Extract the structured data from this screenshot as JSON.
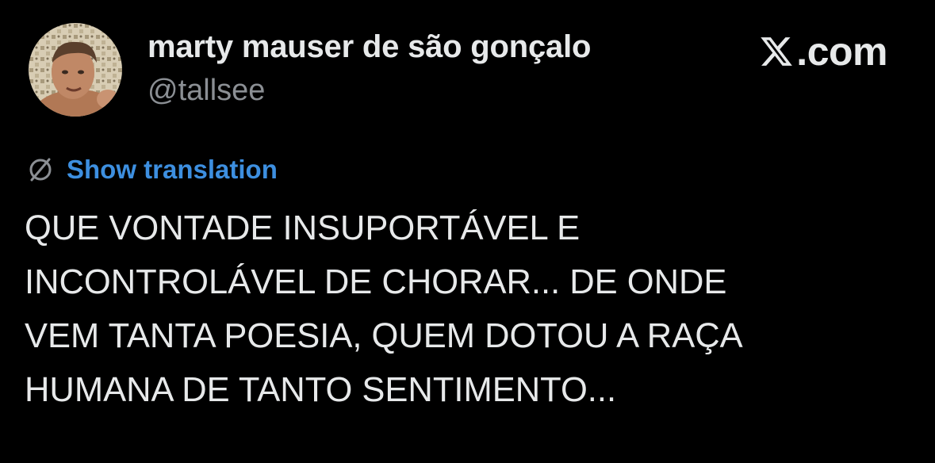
{
  "author": {
    "display_name": "marty mauser de são gonçalo",
    "handle": "@tallsee",
    "avatar_icon": "profile-photo"
  },
  "brand": {
    "logo_icon": "x-logo-icon",
    "text": ".com"
  },
  "translation": {
    "icon": "globe-icon",
    "label": "Show translation"
  },
  "tweet": {
    "lines": [
      "QUE VONTADE INSUPORTÁVEL E",
      "INCONTROLÁVEL DE CHORAR... DE ONDE",
      "VEM TANTA POESIA, QUEM DOTOU A RAÇA",
      "HUMANA DE TANTO SENTIMENTO..."
    ]
  },
  "colors": {
    "background": "#000000",
    "text": "#e7e9ea",
    "secondary": "#8b8f94",
    "link": "#3d8fe0"
  }
}
